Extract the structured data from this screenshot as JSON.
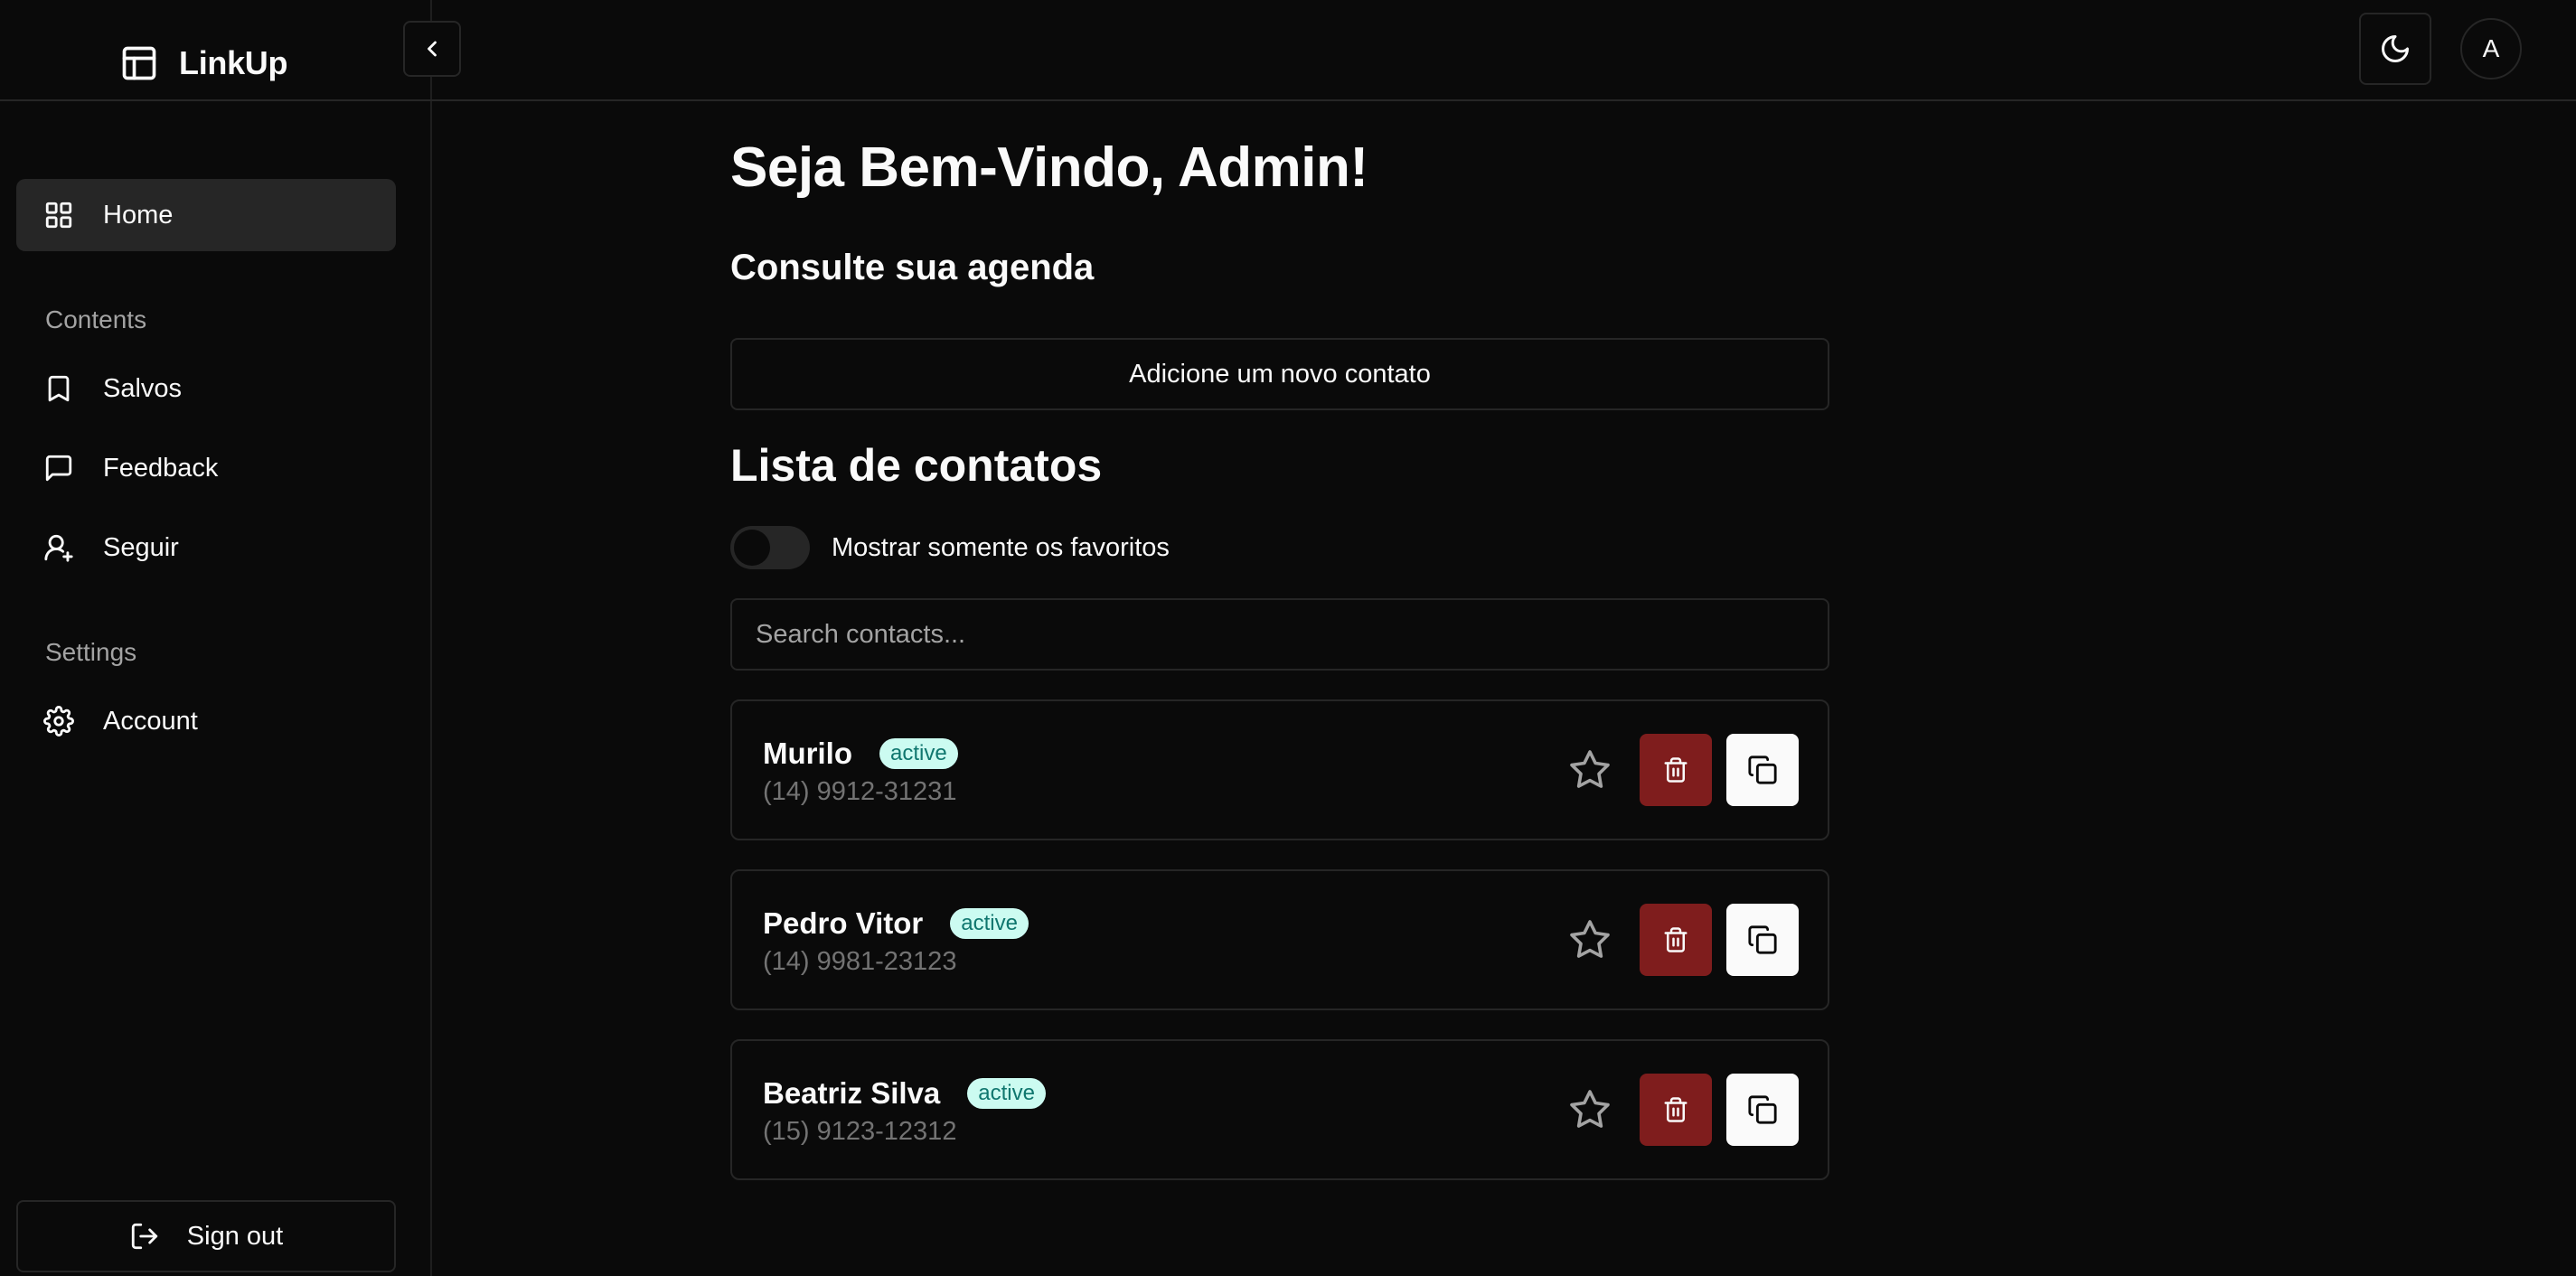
{
  "app": {
    "name": "LinkUp"
  },
  "header": {
    "avatar_initial": "A"
  },
  "sidebar": {
    "home_label": "Home",
    "contents_heading": "Contents",
    "contents_items": [
      {
        "label": "Salvos",
        "icon": "bookmark-icon"
      },
      {
        "label": "Feedback",
        "icon": "message-square-icon"
      },
      {
        "label": "Seguir",
        "icon": "user-plus-icon"
      }
    ],
    "settings_heading": "Settings",
    "account_label": "Account",
    "signout_label": "Sign out"
  },
  "main": {
    "title": "Seja Bem-Vindo, Admin!",
    "subtitle": "Consulte sua agenda",
    "add_button": "Adicione um novo contato",
    "list_title": "Lista de contatos",
    "favorites_toggle_label": "Mostrar somente os favoritos",
    "search_placeholder": "Search contacts...",
    "contacts": [
      {
        "name": "Murilo",
        "status": "active",
        "phone": "(14) 9912-31231"
      },
      {
        "name": "Pedro Vitor",
        "status": "active",
        "phone": "(14) 9981-23123"
      },
      {
        "name": "Beatriz Silva",
        "status": "active",
        "phone": "(15) 9123-12312"
      }
    ]
  },
  "colors": {
    "background": "#0a0a0a",
    "border": "#262626",
    "delete": "#7f1d1d",
    "badge_bg": "#ccfbf1",
    "badge_text": "#0f766e"
  }
}
